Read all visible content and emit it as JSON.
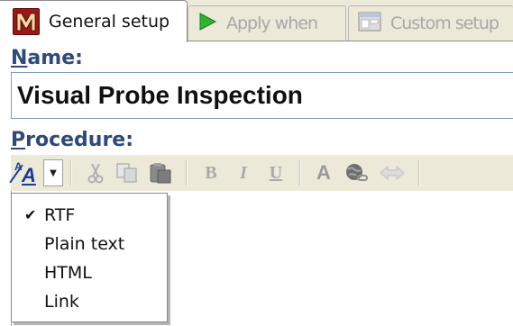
{
  "tabs": [
    {
      "label": "General setup",
      "icon": "m-logo-icon",
      "active": true
    },
    {
      "label": "Apply when",
      "icon": "play-triangle-icon",
      "active": false
    },
    {
      "label": "Custom setup",
      "icon": "window-icon",
      "active": false
    }
  ],
  "form": {
    "name_label_access": "N",
    "name_label_rest": "ame:",
    "name_value": "Visual Probe Inspection",
    "procedure_label_access": "P",
    "procedure_label_rest": "rocedure:"
  },
  "toolbar": {
    "format_icon": "text-format-icon",
    "dropdown_arrow": "▼",
    "buttons": [
      {
        "icon": "cut-icon"
      },
      {
        "icon": "copy-icon"
      },
      {
        "icon": "paste-icon"
      },
      {
        "icon": "bold-icon",
        "glyph": "B"
      },
      {
        "icon": "italic-icon",
        "glyph": "I"
      },
      {
        "icon": "underline-icon",
        "glyph": "U"
      },
      {
        "icon": "font-color-icon",
        "glyph": "A"
      },
      {
        "icon": "insert-link-icon"
      },
      {
        "icon": "navigate-icon"
      }
    ]
  },
  "format_menu": {
    "items": [
      {
        "label": "RTF",
        "checked": true
      },
      {
        "label": "Plain text",
        "checked": false
      },
      {
        "label": "HTML",
        "checked": false
      },
      {
        "label": "Link",
        "checked": false
      }
    ],
    "check_glyph": "✔"
  },
  "colors": {
    "label_blue": "#2f4a7a",
    "toolbar_bg": "#ece9d8",
    "input_border": "#7f9db9",
    "icon_red": "#9c1818",
    "icon_green": "#2db52d"
  }
}
